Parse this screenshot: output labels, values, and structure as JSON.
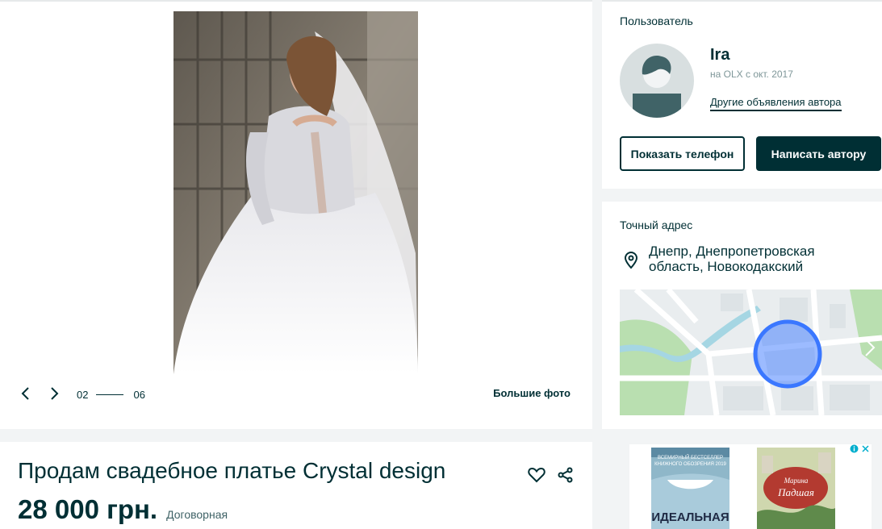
{
  "gallery": {
    "current": "02",
    "total": "06",
    "big_photo_label": "Большие фото"
  },
  "listing": {
    "title": "Продам свадебное платье Crystal design",
    "price": "28 000 грн.",
    "negotiable": "Договорная"
  },
  "user": {
    "section_label": "Пользователь",
    "name": "Ira",
    "member_since": "на OLX с окт. 2017",
    "other_ads_label": "Другие объявления автора",
    "show_phone_label": "Показать телефон",
    "write_label": "Написать автору"
  },
  "location": {
    "section_label": "Точный адрес",
    "address": "Днепр, Днепропетровская область, Новокодакский"
  },
  "ad": {
    "book1_top": "ВСЕМИРНЫЙ БЕСТСЕЛЛЕР",
    "book1_sub": "КНИЖНОГО ОБОЗРЕНИЯ 2019",
    "book1_title": "ИДЕАЛЬНАЯ",
    "book2_author": "Марина",
    "book2_title": "Падшая"
  },
  "colors": {
    "brand_dark": "#002f34",
    "background": "#f2f4f5",
    "map_marker": "#3a77ff",
    "ad_choice": "#00aecd"
  }
}
